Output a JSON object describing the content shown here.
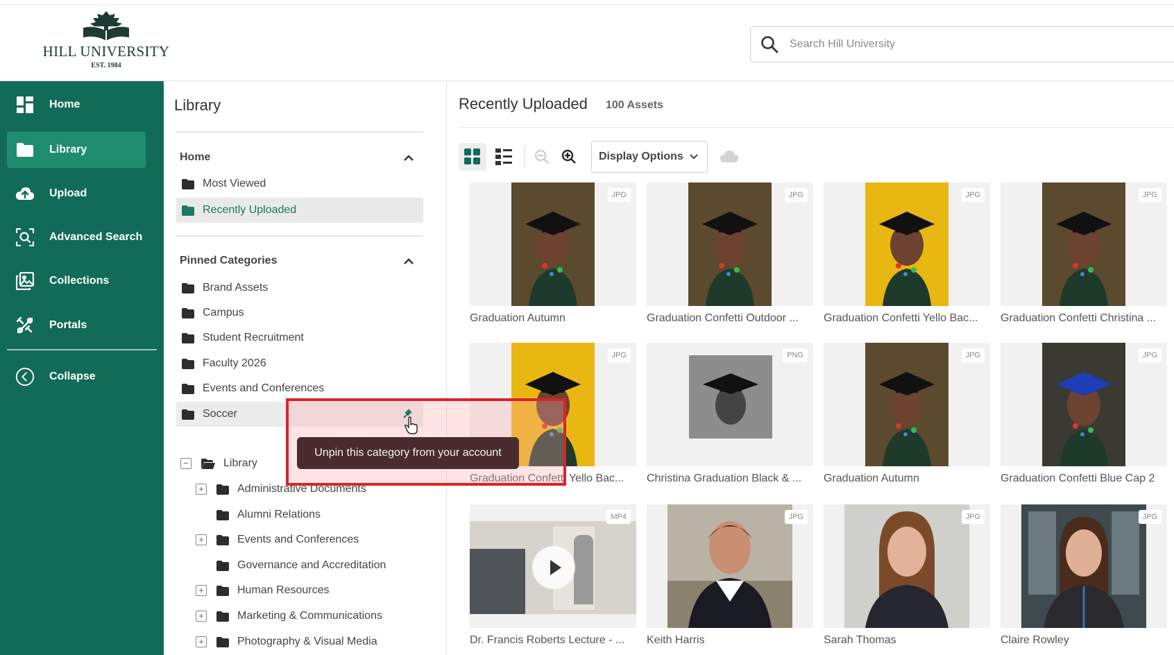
{
  "brand": {
    "name": "HILL UNIVERSITY",
    "est": "EST. 1984",
    "accent": "#126b56",
    "active": "#1f8c6e"
  },
  "search": {
    "placeholder": "Search Hill University"
  },
  "sidebar": {
    "items": [
      {
        "label": "Home",
        "icon": "dashboard-icon"
      },
      {
        "label": "Library",
        "icon": "folder-icon"
      },
      {
        "label": "Upload",
        "icon": "cloud-upload-icon"
      },
      {
        "label": "Advanced Search",
        "icon": "search-scan-icon"
      },
      {
        "label": "Collections",
        "icon": "collections-icon"
      },
      {
        "label": "Portals",
        "icon": "portals-icon"
      }
    ],
    "collapse": "Collapse"
  },
  "library": {
    "title": "Library",
    "home_section": "Home",
    "home_items": [
      "Most Viewed",
      "Recently Uploaded"
    ],
    "pinned_section": "Pinned Categories",
    "pinned_items": [
      "Brand Assets",
      "Campus",
      "Student Recruitment",
      "Faculty 2026",
      "Events and Conferences",
      "Soccer"
    ],
    "tree_root": "Library",
    "tree_items": [
      "Administrative Documents",
      "Alumni Relations",
      "Events and Conferences",
      "Governance and Accreditation",
      "Human Resources",
      "Marketing & Communications",
      "Photography & Visual Media"
    ]
  },
  "tooltip": {
    "text": "Unpin this category from your account"
  },
  "main": {
    "title": "Recently Uploaded",
    "count": "100 Assets",
    "display_options": "Display Options",
    "assets": [
      {
        "title": "Graduation Autumn",
        "type": "JPG",
        "style": "autumn"
      },
      {
        "title": "Graduation Confetti Outdoor ...",
        "type": "JPG",
        "style": "autumn"
      },
      {
        "title": "Graduation Confetti Yello Bac...",
        "type": "JPG",
        "style": "yellow"
      },
      {
        "title": "Graduation Confetti Christina ...",
        "type": "JPG",
        "style": "autumn"
      },
      {
        "title": "Graduation Confetti Yello Bac...",
        "type": "JPG",
        "style": "yellow"
      },
      {
        "title": "Christina Graduation Black & ...",
        "type": "PNG",
        "style": "bw"
      },
      {
        "title": "Graduation Autumn",
        "type": "JPG",
        "style": "autumn"
      },
      {
        "title": "Graduation Confetti Blue Cap 2",
        "type": "JPG",
        "style": "bluecap"
      },
      {
        "title": "Dr. Francis Roberts Lecture - ...",
        "type": "MP4",
        "style": "video"
      },
      {
        "title": "Keith Harris",
        "type": "JPG",
        "style": "portrait-man"
      },
      {
        "title": "Sarah Thomas",
        "type": "JPG",
        "style": "portrait-woman"
      },
      {
        "title": "Claire Rowley",
        "type": "JPG",
        "style": "portrait-office"
      }
    ]
  }
}
